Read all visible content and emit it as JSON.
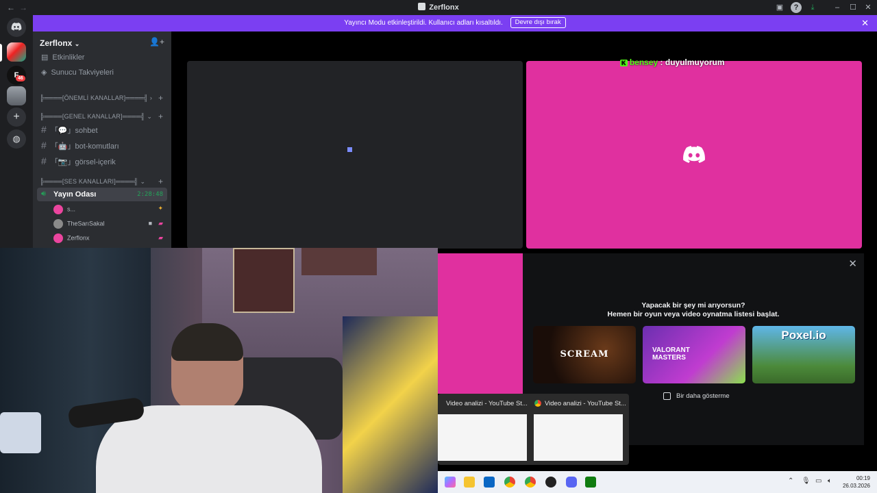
{
  "window": {
    "title": "Zerflonx"
  },
  "banner": {
    "text": "Yayıncı Modu etkinleştirildi. Kullanıcı adları kısaltıldı.",
    "button": "Devre dışı bırak"
  },
  "rail": {
    "badge": "46",
    "server_initial": "F"
  },
  "sidebar": {
    "server_name": "Zerflonx",
    "top_items": [
      "Etkinlikler",
      "Sunucu Takviyeleri"
    ],
    "cat_important": "╠════[ÖNEMLİ KANALLAR]════╣",
    "cat_general": "╠════[GENEL KANALLAR]════╣",
    "channels": [
      {
        "label": "「💬」sohbet"
      },
      {
        "label": "「🤖」bot-komutları"
      },
      {
        "label": "「📷」görsel-içerik"
      }
    ],
    "cat_voice": "╠════[SES KANALLARI]════╣",
    "voice_channel": "Yayın Odası",
    "voice_timer": "2:28:48",
    "voice_users": [
      "s...",
      "TheSarıSakal",
      "Zerflonx"
    ]
  },
  "stage": {
    "tile_label_name": "bensey",
    "tile_label_text": ": duyulmuyorum",
    "tile_label_k": "K"
  },
  "activity": {
    "question": "Yapacak bir şey mi arıyorsun?",
    "subtitle": "Hemen bir oyun veya video oynatma listesi başlat.",
    "cards": [
      "SCREAM",
      "VALORANT MASTERS",
      "Poxel.io"
    ],
    "dont_show": "Bir daha gösterme"
  },
  "preview": {
    "titles": [
      "Video analizi - YouTube St...",
      "Video analizi - YouTube St..."
    ]
  },
  "taskbar": {
    "time": "00:19",
    "date": "26.03.2026"
  },
  "colors": {
    "accent": "#7b3ff2",
    "pink": "#e0309f",
    "green": "#53fc18"
  }
}
